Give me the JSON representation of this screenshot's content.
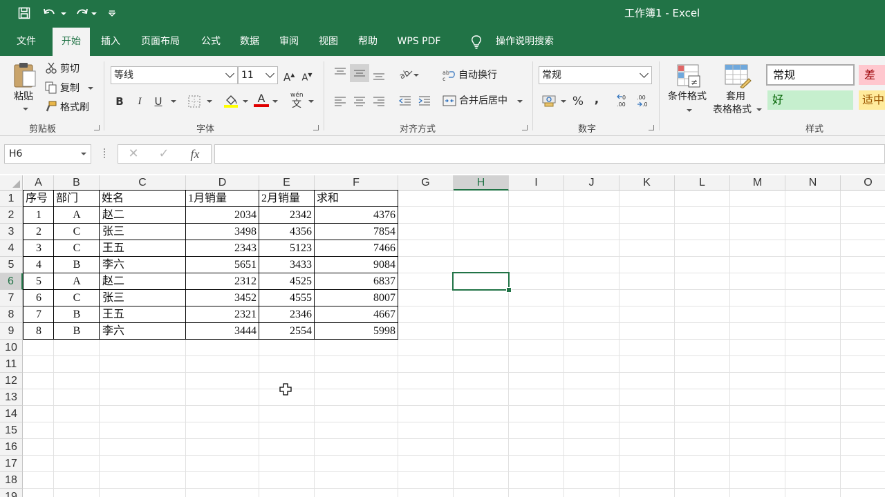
{
  "app": {
    "title": "工作簿1 - Excel"
  },
  "menu": {
    "tabs": [
      {
        "label": "文件"
      },
      {
        "label": "开始"
      },
      {
        "label": "插入"
      },
      {
        "label": "页面布局"
      },
      {
        "label": "公式"
      },
      {
        "label": "数据"
      },
      {
        "label": "审阅"
      },
      {
        "label": "视图"
      },
      {
        "label": "帮助"
      },
      {
        "label": "WPS PDF"
      }
    ],
    "active_tab": "开始",
    "tell_me": "操作说明搜索"
  },
  "ribbon": {
    "clipboard": {
      "paste": "粘贴",
      "cut": "剪切",
      "copy": "复制",
      "format_painter": "格式刷",
      "group": "剪贴板"
    },
    "font": {
      "name": "等线",
      "size": "11",
      "bold": "B",
      "italic": "I",
      "underline": "U",
      "font_color_glyph": "A",
      "phonetic": "文",
      "group": "字体"
    },
    "alignment": {
      "wrap": "自动换行",
      "merge": "合并后居中",
      "group": "对齐方式"
    },
    "number": {
      "format": "常规",
      "percent": "%",
      "comma": ",",
      "group": "数字"
    },
    "styles": {
      "conditional": "条件格式",
      "table_format_1": "套用",
      "table_format_2": "表格格式",
      "normal": "常规",
      "bad": "差",
      "good": "好",
      "neutral": "适中",
      "group": "样式"
    },
    "colors": {
      "bad_bg": "#ffc7ce",
      "bad_fg": "#9c0006",
      "good_bg": "#c6efce",
      "good_fg": "#006100",
      "neutral_bg": "#ffeb9c",
      "neutral_fg": "#9c5700",
      "font_color": "#e00000",
      "fill_color": "#ffff00"
    }
  },
  "formula_bar": {
    "name_box": "H6",
    "cancel": "✕",
    "enter": "✓",
    "fx": "fx",
    "value": ""
  },
  "sheet": {
    "columns": [
      "A",
      "B",
      "C",
      "D",
      "E",
      "F",
      "G",
      "H",
      "I",
      "J",
      "K",
      "L",
      "M",
      "N",
      "O"
    ],
    "rows": [
      "1",
      "2",
      "3",
      "4",
      "5",
      "6",
      "7",
      "8",
      "9",
      "10",
      "11",
      "12",
      "13",
      "14",
      "15",
      "16",
      "17",
      "18",
      "19"
    ],
    "selected_cell": "H6",
    "header": [
      "序号",
      "部门",
      "姓名",
      "1月销量",
      "2月销量",
      "求和"
    ],
    "data": [
      [
        "1",
        "A",
        "赵二",
        "2034",
        "2342",
        "4376"
      ],
      [
        "2",
        "C",
        "张三",
        "3498",
        "4356",
        "7854"
      ],
      [
        "3",
        "C",
        "王五",
        "2343",
        "5123",
        "7466"
      ],
      [
        "4",
        "B",
        "李六",
        "5651",
        "3433",
        "9084"
      ],
      [
        "5",
        "A",
        "赵二",
        "2312",
        "4525",
        "6837"
      ],
      [
        "6",
        "C",
        "张三",
        "3452",
        "4555",
        "8007"
      ],
      [
        "7",
        "B",
        "王五",
        "2321",
        "2346",
        "4667"
      ],
      [
        "8",
        "B",
        "李六",
        "3444",
        "2554",
        "5998"
      ]
    ]
  }
}
